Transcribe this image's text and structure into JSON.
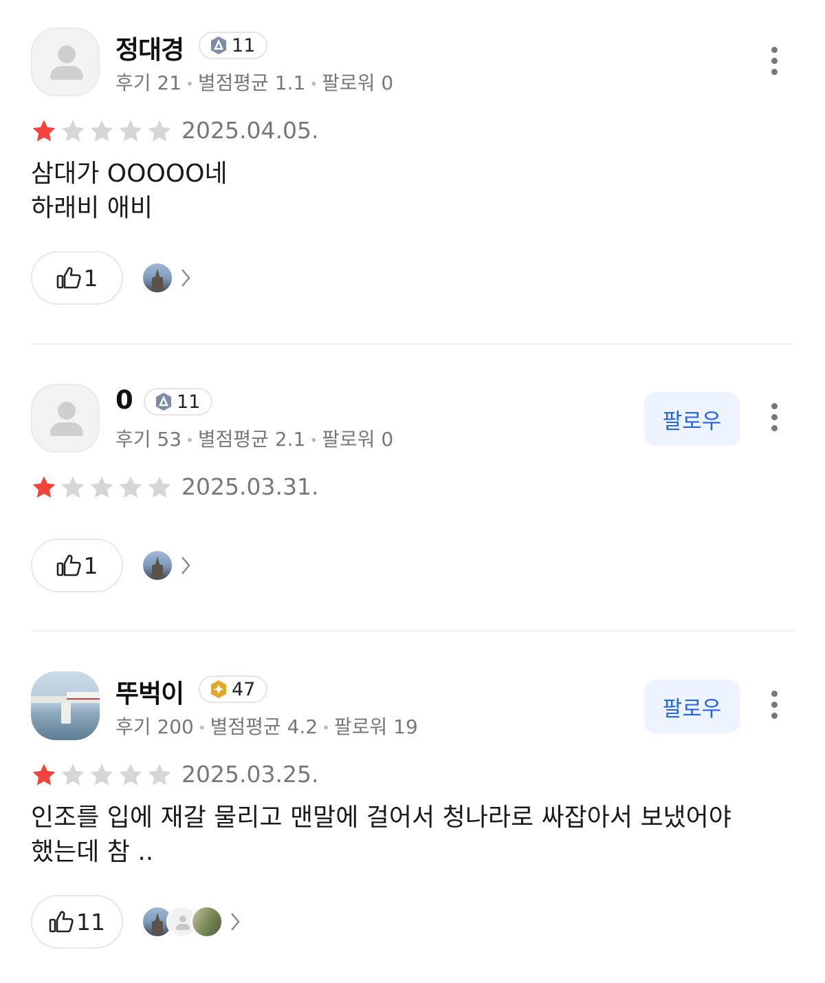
{
  "reviews": [
    {
      "name": "정대경",
      "level": "11",
      "level_color": "#7f8ca5",
      "stats": {
        "reviews": "후기 21",
        "rating_avg": "별점평균 1.1",
        "followers": "팔로워 0"
      },
      "follow_label": "",
      "rating": 1,
      "date": "2025.04.05.",
      "text": "삼대가 OOOOO네\n하래비 애비",
      "likes": "1",
      "reactor_icons": [
        "castle-photo"
      ]
    },
    {
      "name": "0",
      "level": "11",
      "level_color": "#7f8ca5",
      "stats": {
        "reviews": "후기 53",
        "rating_avg": "별점평균 2.1",
        "followers": "팔로워 0"
      },
      "follow_label": "팔로우",
      "rating": 1,
      "date": "2025.03.31.",
      "text": "",
      "likes": "1",
      "reactor_icons": [
        "castle-photo"
      ]
    },
    {
      "name": "뚜벅이",
      "level": "47",
      "level_color": "#e0a92e",
      "stats": {
        "reviews": "후기 200",
        "rating_avg": "별점평균 4.2",
        "followers": "팔로워 19"
      },
      "follow_label": "팔로우",
      "rating": 1,
      "date": "2025.03.25.",
      "text": "인조를 입에 재갈 물리고 맨말에 걸어서 청나라로 싸잡아서 보냈어야\n했는데 참 ..",
      "likes": "11",
      "reactor_icons": [
        "castle-photo",
        "default-avatar",
        "moss-photo"
      ]
    }
  ],
  "colors": {
    "star_filled": "#f5433b",
    "star_empty": "#d6d6d6",
    "follow_text": "#2464e8",
    "follow_bg": "#eef4ff"
  },
  "icons": {
    "more": "vertical-dots-icon",
    "like": "thumbs-up-icon",
    "chevron": "chevron-right-icon",
    "star": "star-icon"
  }
}
